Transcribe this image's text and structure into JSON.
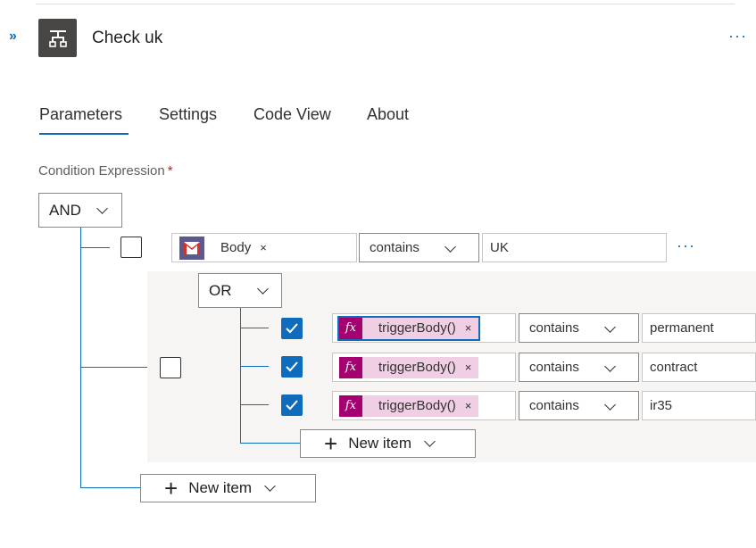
{
  "header": {
    "expand_label": "»",
    "title": "Check uk",
    "more_label": "···"
  },
  "tabs": [
    {
      "label": "Parameters",
      "active": true
    },
    {
      "label": "Settings"
    },
    {
      "label": "Code View"
    },
    {
      "label": "About"
    }
  ],
  "condition": {
    "label": "Condition Expression",
    "required_mark": "*",
    "root_operator": "AND",
    "row1": {
      "token": "Body",
      "token_icon": "gmail-icon",
      "close": "×",
      "operator": "contains",
      "value": "UK",
      "more": "···"
    },
    "group": {
      "operator": "OR",
      "rows": [
        {
          "fx": "fx",
          "token": "triggerBody()",
          "close": "×",
          "operator": "contains",
          "value": "permanent",
          "checked": true
        },
        {
          "fx": "fx",
          "token": "triggerBody()",
          "close": "×",
          "operator": "contains",
          "value": "contract",
          "checked": true
        },
        {
          "fx": "fx",
          "token": "triggerBody()",
          "close": "×",
          "operator": "contains",
          "value": "ir35",
          "checked": true
        }
      ],
      "new_item": "New item"
    },
    "new_item": "New item"
  },
  "colors": {
    "accent": "#0f6cbd",
    "fx_token_bg": "#f0cfe5",
    "fx_icon_bg": "#a4006f",
    "action_icon_bg": "#484644"
  }
}
